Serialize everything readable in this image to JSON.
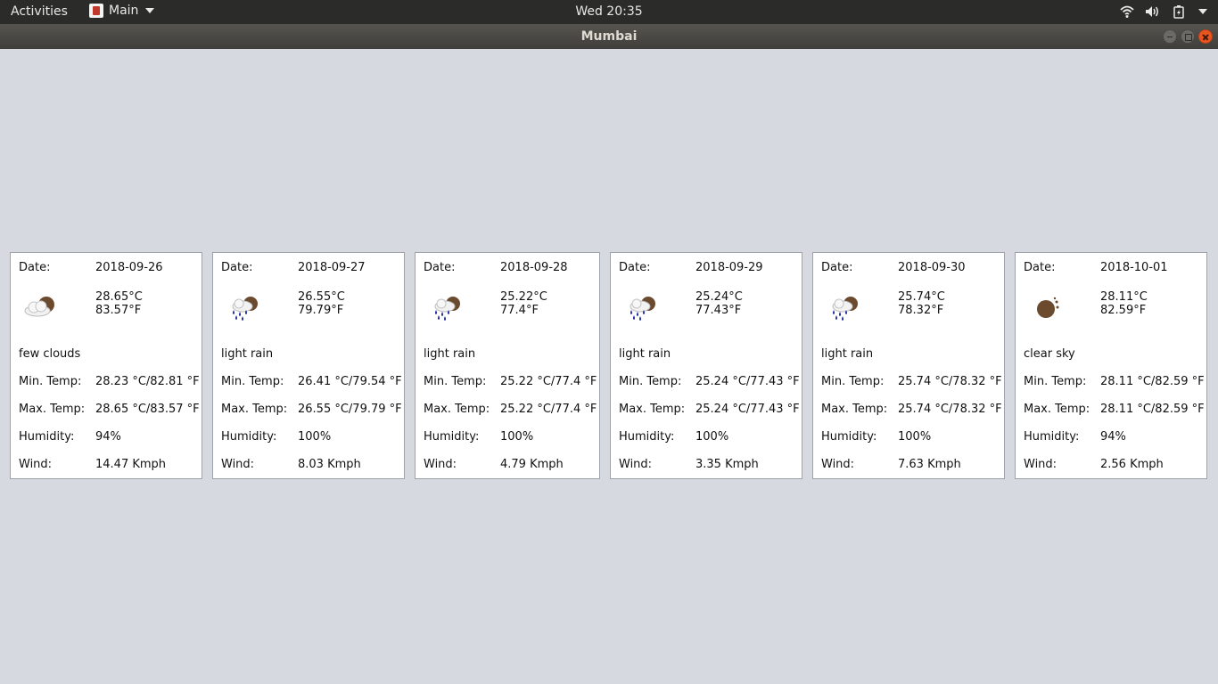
{
  "topbar": {
    "activities": "Activities",
    "app_menu": "Main",
    "clock": "Wed 20:35",
    "tray_icons": [
      "wifi-icon",
      "volume-icon",
      "battery-icon",
      "system-menu-caret"
    ]
  },
  "window": {
    "title": "Mumbai"
  },
  "labels": {
    "date": "Date:",
    "min_temp": "Min. Temp:",
    "max_temp": "Max. Temp:",
    "humidity": "Humidity:",
    "wind": "Wind:"
  },
  "forecast": [
    {
      "date": "2018-09-26",
      "temp_c": "28.65°C",
      "temp_f": "83.57°F",
      "description": "few clouds",
      "icon": "few-clouds-icon",
      "min_temp": "28.23 °C/82.81 °F",
      "max_temp": "28.65 °C/83.57 °F",
      "humidity": "94%",
      "wind": "14.47 Kmph"
    },
    {
      "date": "2018-09-27",
      "temp_c": "26.55°C",
      "temp_f": "79.79°F",
      "description": "light rain",
      "icon": "light-rain-icon",
      "min_temp": "26.41 °C/79.54 °F",
      "max_temp": "26.55 °C/79.79 °F",
      "humidity": "100%",
      "wind": "8.03 Kmph"
    },
    {
      "date": "2018-09-28",
      "temp_c": "25.22°C",
      "temp_f": "77.4°F",
      "description": "light rain",
      "icon": "light-rain-icon",
      "min_temp": "25.22 °C/77.4 °F",
      "max_temp": "25.22 °C/77.4 °F",
      "humidity": "100%",
      "wind": "4.79 Kmph"
    },
    {
      "date": "2018-09-29",
      "temp_c": "25.24°C",
      "temp_f": "77.43°F",
      "description": "light rain",
      "icon": "light-rain-icon",
      "min_temp": "25.24 °C/77.43 °F",
      "max_temp": "25.24 °C/77.43 °F",
      "humidity": "100%",
      "wind": "3.35 Kmph"
    },
    {
      "date": "2018-09-30",
      "temp_c": "25.74°C",
      "temp_f": "78.32°F",
      "description": "light rain",
      "icon": "light-rain-icon",
      "min_temp": "25.74 °C/78.32 °F",
      "max_temp": "25.74 °C/78.32 °F",
      "humidity": "100%",
      "wind": "7.63 Kmph"
    },
    {
      "date": "2018-10-01",
      "temp_c": "28.11°C",
      "temp_f": "82.59°F",
      "description": "clear sky",
      "icon": "clear-sky-icon",
      "min_temp": "28.11 °C/82.59 °F",
      "max_temp": "28.11 °C/82.59 °F",
      "humidity": "94%",
      "wind": "2.56 Kmph"
    }
  ]
}
